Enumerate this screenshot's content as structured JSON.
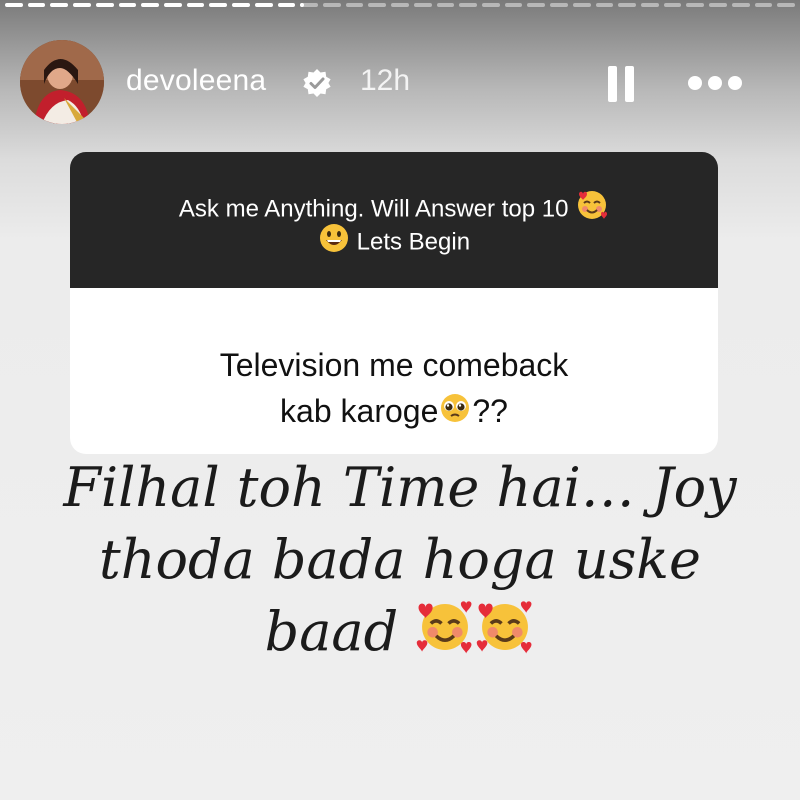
{
  "story": {
    "progress_segments": [
      1,
      1,
      1,
      1,
      1,
      1,
      1,
      1,
      1,
      1,
      1,
      1,
      1,
      0,
      0,
      0,
      0,
      0,
      0,
      0,
      0,
      0,
      0,
      0,
      0,
      0,
      0,
      0,
      0,
      0,
      0,
      0,
      0,
      0,
      0
    ],
    "current_segment_progress": 0.2
  },
  "header": {
    "username": "devoleena",
    "verified_icon": "verified-badge-icon",
    "time": "12h",
    "pause_icon": "pause-icon",
    "more_icon": "more-dots-icon"
  },
  "question_card": {
    "prompt_line1": "Ask me Anything. Will Answer top 10",
    "prompt_line2": "Lets Begin",
    "prompt_emoji_1": "smiling-face-with-hearts-emoji",
    "prompt_emoji_2": "grinning-face-emoji",
    "question_line1": "Television me comeback",
    "question_line2": "kab karoge",
    "question_suffix": "??",
    "question_emoji": "pleading-face-emoji"
  },
  "answer": {
    "line1": "Filhal toh Time hai… Joy",
    "line2": "thoda bada hoga uske",
    "line3": "baad",
    "emojis": [
      "smiling-face-with-hearts-emoji",
      "smiling-face-with-hearts-emoji"
    ]
  },
  "colors": {
    "card_header_bg": "#262626",
    "card_body_bg": "#ffffff",
    "text_dark": "#111111"
  }
}
